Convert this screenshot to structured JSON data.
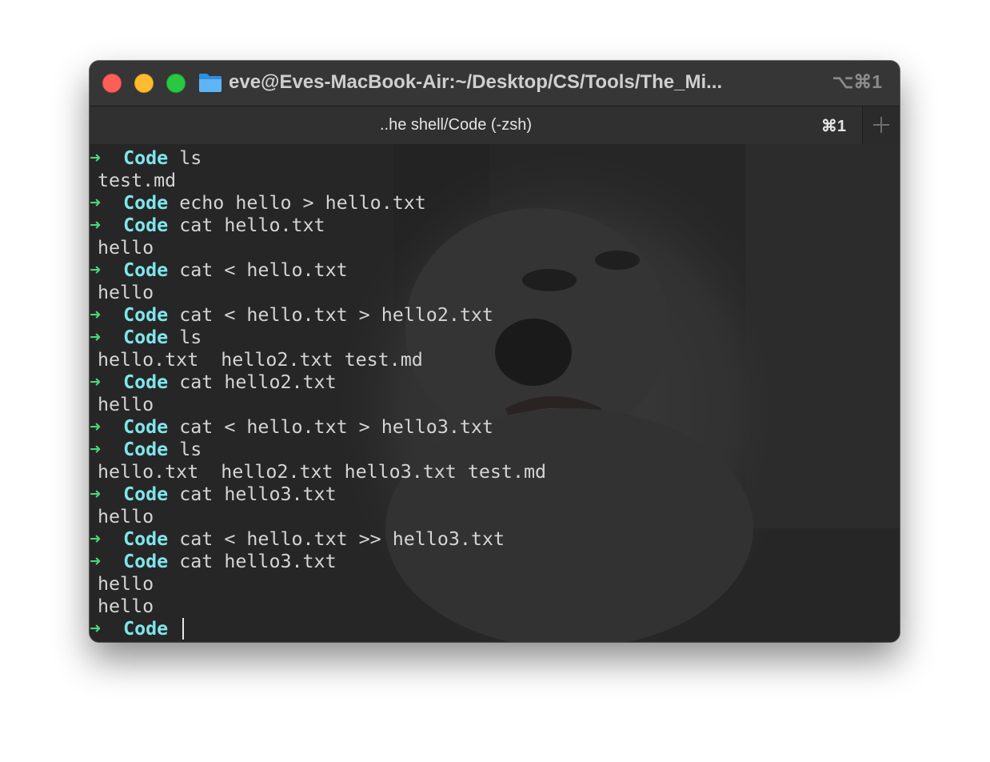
{
  "window": {
    "title": "eve@Eves-MacBook-Air:~/Desktop/CS/Tools/The_Mi...",
    "shortcut": "⌥⌘1"
  },
  "tab": {
    "title": "..he shell/Code (-zsh)",
    "shortcut": "⌘1",
    "new_tab_symbol": "+"
  },
  "colors": {
    "prompt_arrow": "#4fd27a",
    "prompt_dir": "#7ee6ec",
    "text": "#d4d4d4",
    "background": "#262626"
  },
  "terminal": {
    "prompt_symbol": "➜",
    "lines": [
      {
        "type": "prompt",
        "dir": "Code",
        "cmd": "ls"
      },
      {
        "type": "output",
        "text": "test.md"
      },
      {
        "type": "prompt",
        "dir": "Code",
        "cmd": "echo hello > hello.txt"
      },
      {
        "type": "prompt",
        "dir": "Code",
        "cmd": "cat hello.txt"
      },
      {
        "type": "output",
        "text": "hello"
      },
      {
        "type": "prompt",
        "dir": "Code",
        "cmd": "cat < hello.txt"
      },
      {
        "type": "output",
        "text": "hello"
      },
      {
        "type": "prompt",
        "dir": "Code",
        "cmd": "cat < hello.txt > hello2.txt"
      },
      {
        "type": "prompt",
        "dir": "Code",
        "cmd": "ls"
      },
      {
        "type": "output",
        "text": "hello.txt  hello2.txt test.md"
      },
      {
        "type": "prompt",
        "dir": "Code",
        "cmd": "cat hello2.txt"
      },
      {
        "type": "output",
        "text": "hello"
      },
      {
        "type": "prompt",
        "dir": "Code",
        "cmd": "cat < hello.txt > hello3.txt"
      },
      {
        "type": "prompt",
        "dir": "Code",
        "cmd": "ls"
      },
      {
        "type": "output",
        "text": "hello.txt  hello2.txt hello3.txt test.md"
      },
      {
        "type": "prompt",
        "dir": "Code",
        "cmd": "cat hello3.txt"
      },
      {
        "type": "output",
        "text": "hello"
      },
      {
        "type": "prompt",
        "dir": "Code",
        "cmd": "cat < hello.txt >> hello3.txt"
      },
      {
        "type": "prompt",
        "dir": "Code",
        "cmd": "cat hello3.txt"
      },
      {
        "type": "output",
        "text": "hello"
      },
      {
        "type": "output",
        "text": "hello"
      },
      {
        "type": "prompt",
        "dir": "Code",
        "cmd": "",
        "cursor": true
      }
    ]
  }
}
